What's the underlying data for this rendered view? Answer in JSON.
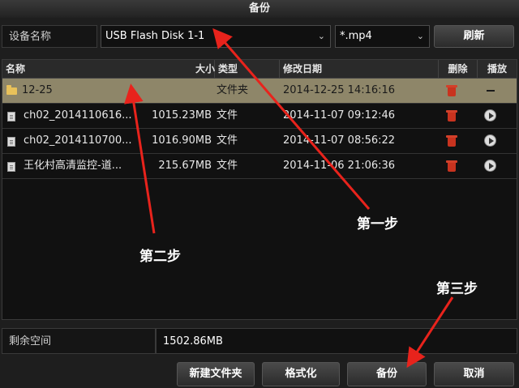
{
  "window": {
    "title": "备份"
  },
  "toolbar": {
    "device_label": "设备名称",
    "device_value": "USB Flash Disk 1-1",
    "filetype_value": "*.mp4",
    "refresh_label": "刷新"
  },
  "table": {
    "headers": {
      "name": "名称",
      "size": "大小",
      "type": "类型",
      "date": "修改日期",
      "delete": "删除",
      "play": "播放"
    },
    "rows": [
      {
        "name": "12-25",
        "size": "",
        "type": "文件夹",
        "date": "2014-12-25 14:16:16",
        "icon": "folder-icon",
        "selected": true
      },
      {
        "name": "ch02_2014110616...",
        "size": "1015.23MB",
        "type": "文件",
        "date": "2014-11-07 09:12:46",
        "icon": "file-icon",
        "selected": false
      },
      {
        "name": "ch02_2014110700...",
        "size": "1016.90MB",
        "type": "文件",
        "date": "2014-11-07 08:56:22",
        "icon": "file-icon",
        "selected": false
      },
      {
        "name": "王化村高清监控-道...",
        "size": "215.67MB",
        "type": "文件",
        "date": "2014-11-06 21:06:36",
        "icon": "file-icon",
        "selected": false
      }
    ]
  },
  "free_space": {
    "label": "剩余空间",
    "value": "1502.86MB"
  },
  "buttons": {
    "new_folder": "新建文件夹",
    "format": "格式化",
    "backup": "备份",
    "cancel": "取消"
  },
  "annotations": {
    "step1": "第一步",
    "step2": "第二步",
    "step3": "第三步"
  },
  "colors": {
    "selected_row": "#8e8669",
    "arrow": "#e8231c",
    "trash": "#c8331f"
  }
}
